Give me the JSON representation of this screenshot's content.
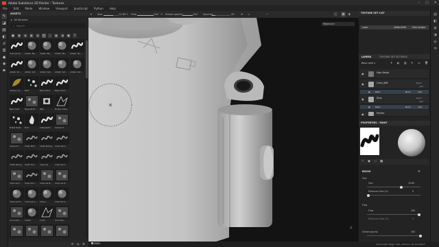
{
  "window": {
    "title": "Adobe Substance 3D Painter - Textures",
    "controls": [
      "–",
      "▢",
      "✕"
    ]
  },
  "menu": [
    "File",
    "Edit",
    "Mode",
    "Window",
    "Viewport",
    "JavaScript",
    "Python",
    "Help"
  ],
  "toolbar": {
    "size_label": "Size",
    "size_value": "12.83",
    "flow_label": "Flow",
    "flow_value": "100",
    "stroke_opacity_label": "Stroke opacity",
    "stroke_opacity_value": "100",
    "spacing_label": "Spacing",
    "spacing_value": "20",
    "spacing_percent": 20,
    "material_dropdown": "Material"
  },
  "assets": {
    "title": "ASSETS",
    "library": "All libraries",
    "search_placeholder": "Search",
    "thumbs": [
      {
        "label": "Airbrush St...",
        "kind": "stroke"
      },
      {
        "label": "Artistic Ba...",
        "kind": "soft"
      },
      {
        "label": "Artistic Ba...",
        "kind": "soft"
      },
      {
        "label": "Artistic Ba...",
        "kind": "soft"
      },
      {
        "label": "Artistic Ha...",
        "kind": "stroke"
      },
      {
        "label": "Artistic Pri...",
        "kind": "stroke"
      },
      {
        "label": "Artistic Sof...",
        "kind": "soft"
      },
      {
        "label": "Artistic Sof...",
        "kind": "soft"
      },
      {
        "label": "Artistic Sof...",
        "kind": "soft"
      },
      {
        "label": "Artistic Sof...",
        "kind": "soft"
      },
      {
        "label": "Autumn Le...",
        "kind": "leaf"
      },
      {
        "label": "Bark",
        "kind": "dots"
      },
      {
        "label": "Basic Hard",
        "kind": "stroke"
      },
      {
        "label": "Basic Hard...",
        "kind": "stroke"
      },
      {
        "label": "",
        "kind": "blank"
      },
      {
        "label": "Basic Soft",
        "kind": "stroke"
      },
      {
        "label": "Basmati Br...",
        "kind": "grain"
      },
      {
        "label": "Bite",
        "kind": "bite"
      },
      {
        "label": "Broken Glass",
        "kind": "shard"
      },
      {
        "label": "",
        "kind": "blank"
      },
      {
        "label": "Bullet Holes",
        "kind": "dots"
      },
      {
        "label": "Burn",
        "kind": "flame"
      },
      {
        "label": "Calligraphic",
        "kind": "stroke"
      },
      {
        "label": "Cement 1",
        "kind": "grain"
      },
      {
        "label": "",
        "kind": "blank"
      },
      {
        "label": "Cement 2",
        "kind": "grain"
      },
      {
        "label": "Chalk Bold",
        "kind": "chalk"
      },
      {
        "label": "Chalk Bumpy",
        "kind": "chalk"
      },
      {
        "label": "Chalk Spre...",
        "kind": "chalk"
      },
      {
        "label": "",
        "kind": "blank"
      },
      {
        "label": "Chalk Strong",
        "kind": "chalk"
      },
      {
        "label": "Chalk Thin",
        "kind": "chalk"
      },
      {
        "label": "Charcoal",
        "kind": "chalk"
      },
      {
        "label": "Charcoal F...",
        "kind": "chalk"
      },
      {
        "label": "",
        "kind": "blank"
      },
      {
        "label": "Charcoal F...",
        "kind": "grain"
      },
      {
        "label": "Charcoal L...",
        "kind": "chalk"
      },
      {
        "label": "Charcoal N...",
        "kind": "grain"
      },
      {
        "label": "Charcoal R...",
        "kind": "grain"
      },
      {
        "label": "",
        "kind": "blank"
      },
      {
        "label": "Charcoal Pr...",
        "kind": "soft"
      },
      {
        "label": "Charcoal S...",
        "kind": "soft"
      },
      {
        "label": "Cloud...",
        "kind": "soft"
      },
      {
        "label": "Charcoal S...",
        "kind": "soft"
      },
      {
        "label": "",
        "kind": "blank"
      },
      {
        "label": "Concrete L...",
        "kind": "grain"
      },
      {
        "label": "Cotton",
        "kind": "soft"
      },
      {
        "label": "Crack",
        "kind": "shard"
      },
      {
        "label": "Concrete...",
        "kind": "grain"
      },
      {
        "label": "",
        "kind": "blank"
      },
      {
        "label": "",
        "kind": "grain"
      },
      {
        "label": "",
        "kind": "grain"
      },
      {
        "label": "",
        "kind": "grain"
      },
      {
        "label": "",
        "kind": "grain"
      }
    ]
  },
  "texture_set_list": {
    "title": "TEXTURE SET LIST",
    "set_name": "Lazer",
    "resolution": "4096x4096",
    "shader": "Main shader"
  },
  "layers": {
    "tab_layers": "LAYERS",
    "tab_settings": "TEXTURE SET SETTINGS",
    "channel": "Base color",
    "items": [
      {
        "name": "High Detail",
        "mode": "",
        "opacity": ""
      },
      {
        "name": "Lines_WM",
        "mode": "Norm",
        "opacity": "100"
      },
      {
        "name": "Dirty",
        "mode": "Norm",
        "opacity": "100"
      },
      {
        "name": "Painter",
        "mode": "",
        "opacity": ""
      }
    ],
    "sub_items": [
      {
        "label": "Paint",
        "mode": "Norm",
        "opacity": "100"
      },
      {
        "label": "Paint",
        "mode": "Norm",
        "opacity": "100"
      }
    ]
  },
  "properties": {
    "title": "PROPERTIES - PAINT",
    "brush_section": "BRUSH",
    "size_group": "Size",
    "size_label": "Size",
    "size_value": "12.83",
    "size_percent": 65,
    "min_size_label": "Minimum Size (%)",
    "min_size_value": "0",
    "min_size_percent": 0,
    "flow_group": "Flow",
    "flow_label": "Flow",
    "flow_value": "100",
    "flow_percent": 100,
    "min_flow_label": "Minimum Flow (%)",
    "min_flow_value": "0",
    "stroke_opacity_label": "Stroke opacity",
    "stroke_opacity_value": "100"
  },
  "viewport_bottom": {
    "mode": "MAIN"
  },
  "status_bar": "Cache Disk Usage: 34% | Version: 10.1.0-beta-F",
  "colors": {
    "accent_blue": "#4a8fd8",
    "panel_bg": "#232323",
    "viewport_bg": "#131313"
  }
}
